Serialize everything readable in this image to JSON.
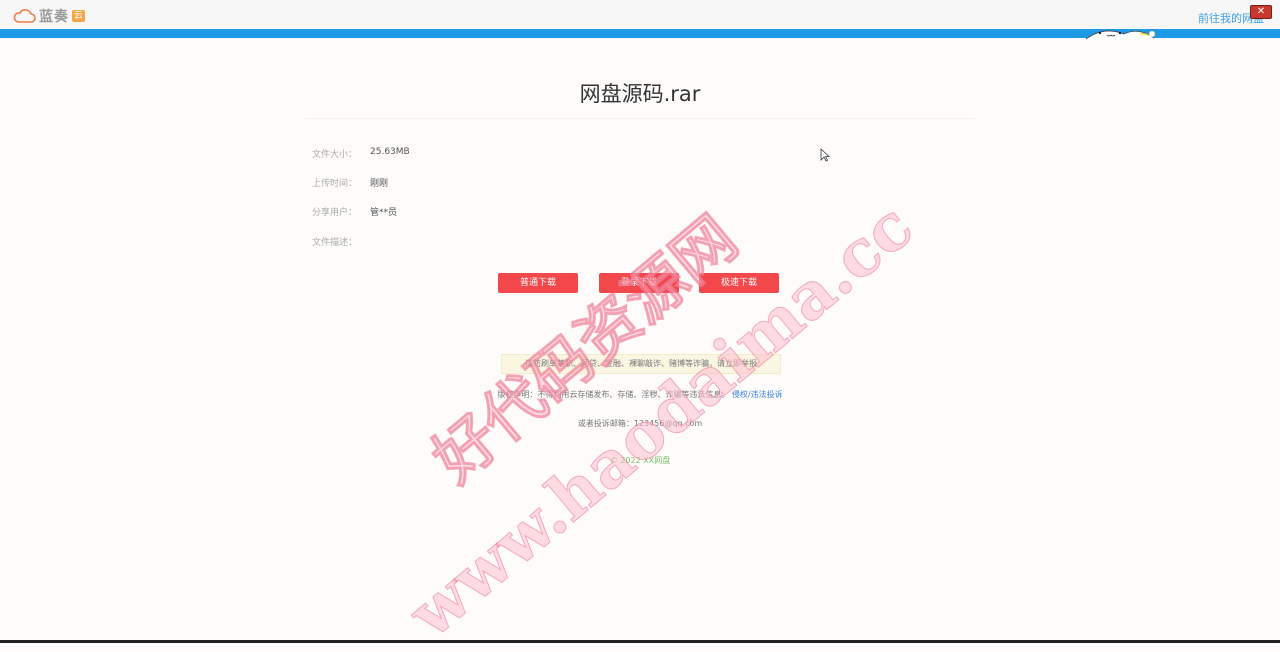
{
  "topbar": {
    "logo_text": "蓝奏",
    "logo_badge": "云",
    "link_label": "前往我的网盘",
    "close_label": "✕"
  },
  "file": {
    "title": "网盘源码.rar",
    "info": [
      {
        "label": "文件大小：",
        "value": "25.63MB"
      },
      {
        "label": "上传时间：",
        "value": "刚刚"
      },
      {
        "label": "分享用户：",
        "value": "管**员"
      },
      {
        "label": "文件描述：",
        "value": ""
      }
    ]
  },
  "buttons": {
    "normal": "普通下载",
    "login": "登录下载",
    "fast": "极速下载"
  },
  "notice": "谨防刷单兼职、网贷、金融、裸聊敲诈、赌博等诈骗，请立即举报",
  "disclaimer": {
    "text": "版权声明：不得利用云存储发布、存储、淫秽、诈骗等违法信息。",
    "link": "侵权/违法投诉"
  },
  "contact": "或者投诉邮箱：123456@qq.com",
  "footer": "© 2022 XX网盘",
  "watermark": {
    "line1": "好代码资源网",
    "line2": "www.haodaima.cc"
  },
  "colors": {
    "accent_blue": "#1e9ae5",
    "button_red": "#f2484b",
    "footer_green": "#7cbf6a",
    "link_blue": "#3d7ee0"
  }
}
